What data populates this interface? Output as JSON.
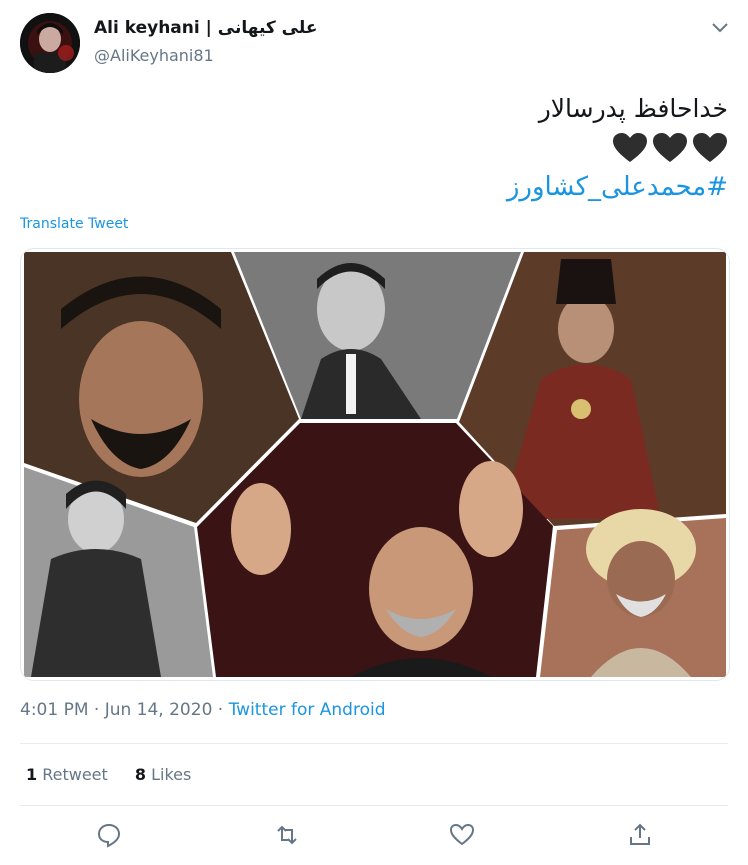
{
  "author": {
    "name": "Ali keyhani | علی کیهانی",
    "handle": "@AliKeyhani81",
    "avatar_icon": "avatar-photo"
  },
  "tweet": {
    "line1": "خداحافظ پدرسالار",
    "hearts": [
      "black-heart-icon",
      "black-heart-icon",
      "black-heart-icon"
    ],
    "hashtag": "#محمدعلی_کشاورز",
    "translate_label": "Translate Tweet"
  },
  "media": {
    "description_icon": "photo-collage",
    "tile_count": 6
  },
  "meta": {
    "time": "4:01 PM · Jun 14, 2020 · ",
    "app": "Twitter for Android"
  },
  "stats": {
    "retweets_count": "1",
    "retweets_label": "Retweet",
    "likes_count": "8",
    "likes_label": "Likes"
  },
  "actions": [
    "reply-icon",
    "retweet-icon",
    "like-icon",
    "share-icon"
  ],
  "colors": {
    "link": "#1b95e0",
    "secondary": "#657786",
    "divider": "#e6ecf0"
  }
}
